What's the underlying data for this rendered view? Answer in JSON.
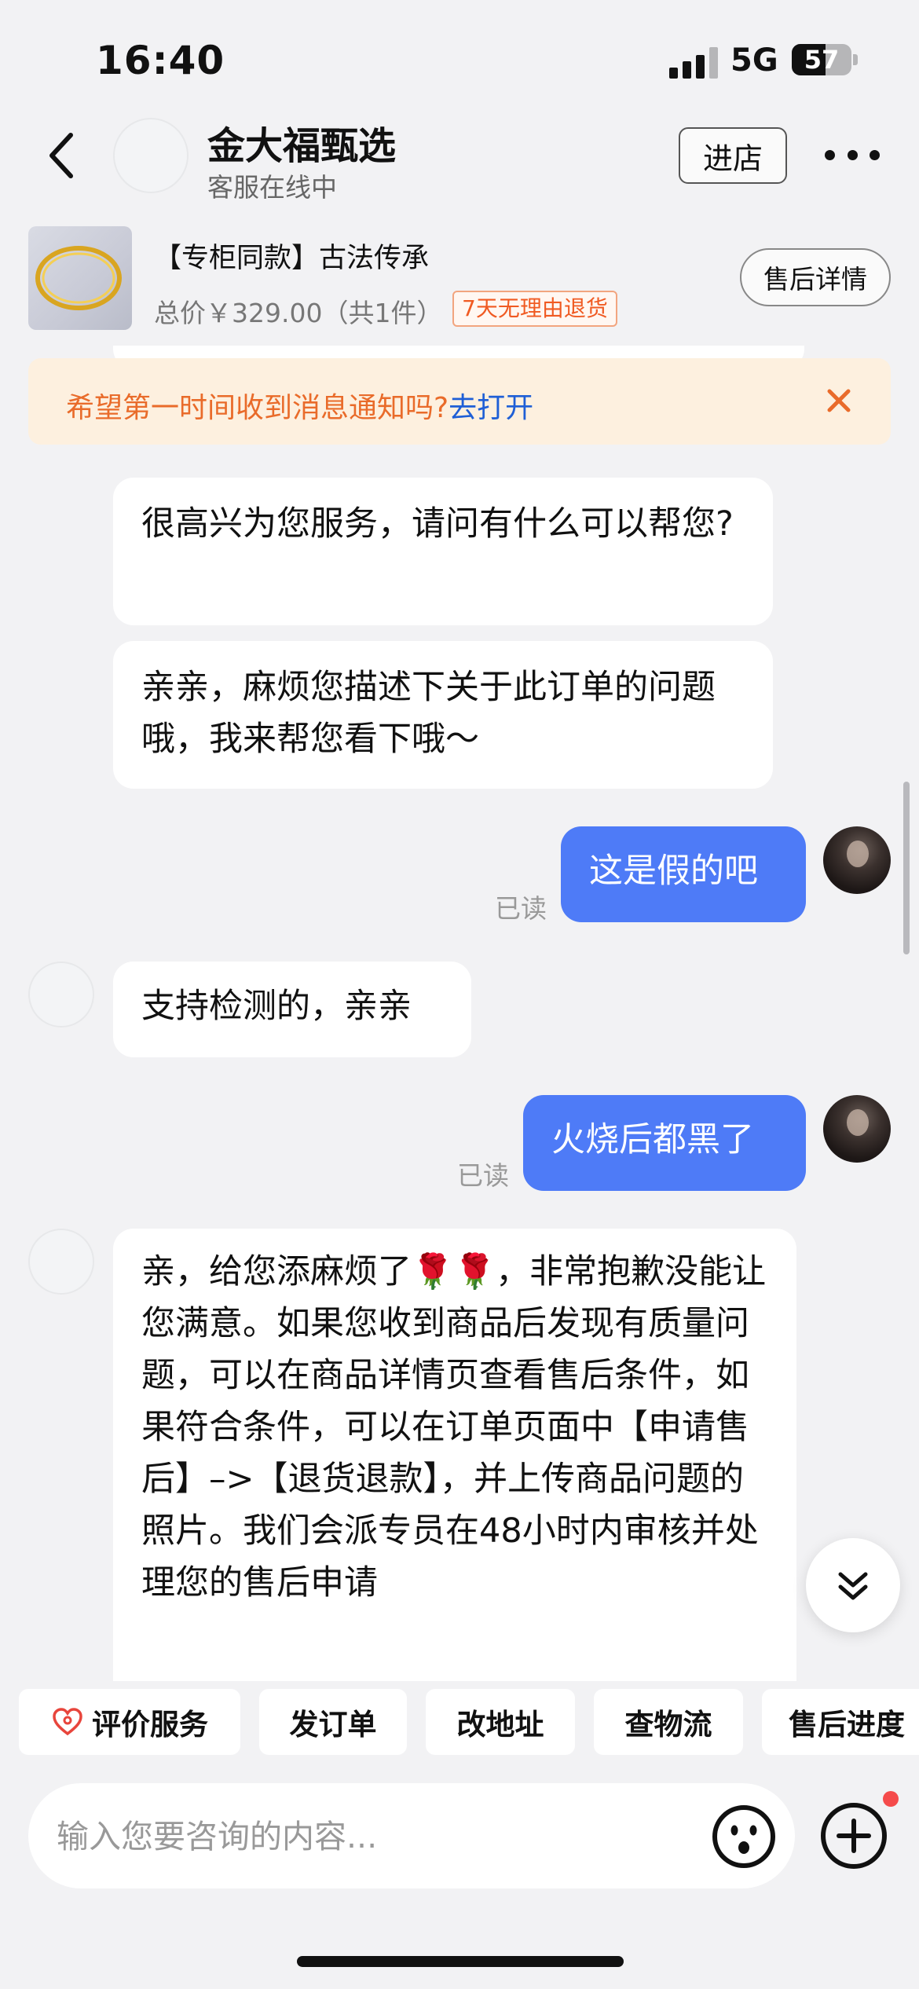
{
  "status_bar": {
    "time": "16:40",
    "network": "5G",
    "battery": "57",
    "battery_level": 0.57
  },
  "header": {
    "shop_name": "金大福甄选",
    "shop_status": "客服在线中",
    "enter_store_label": "进店"
  },
  "product": {
    "title": "【专柜同款】古法传承",
    "price": "总价￥329.00（共1件）",
    "return_tag": "7天无理由退货",
    "after_sale_label": "售后详情"
  },
  "notice": {
    "text": "希望第一时间收到消息通知吗?",
    "link": "去打开"
  },
  "messages": [
    {
      "from": "agent",
      "text": "很高兴为您服务，请问有什么可以帮您?"
    },
    {
      "from": "agent",
      "text": "亲亲，麻烦您描述下关于此订单的问题哦，我来帮您看下哦～"
    },
    {
      "from": "user",
      "text": "这是假的吧",
      "status": "已读"
    },
    {
      "from": "agent",
      "text": "支持检测的，亲亲"
    },
    {
      "from": "user",
      "text": "火烧后都黑了",
      "status": "已读"
    },
    {
      "from": "agent",
      "text": "亲，给您添麻烦了🌹🌹，非常抱歉没能让您满意。如果您收到商品后发现有质量问题，可以在商品详情页查看售后条件，如果符合条件，可以在订单页面中【申请售后】–>【退货退款】，并上传商品问题的照片。我们会派专员在48小时内审核并处理您的售后申请"
    }
  ],
  "quick_actions": [
    "评价服务",
    "发订单",
    "改地址",
    "查物流",
    "售后进度"
  ],
  "input": {
    "placeholder": "输入您要咨询的内容..."
  },
  "colors": {
    "accent": "#4e7bf7",
    "notice_bg": "#fdf0df",
    "notice_text": "#e96b2a",
    "link": "#1f5fd6",
    "tag": "#f05a22"
  },
  "icons": [
    "back-arrow-icon",
    "more-icon",
    "close-icon",
    "heart-icon",
    "chevron-double-down-icon",
    "emoji-icon",
    "plus-icon"
  ]
}
